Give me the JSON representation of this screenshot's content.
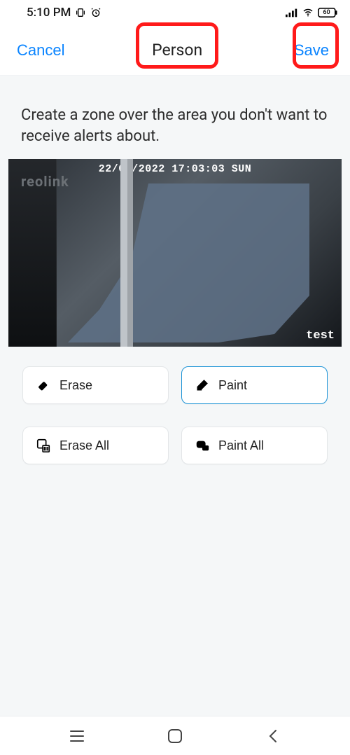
{
  "status": {
    "time": "5:10 PM",
    "battery": "60"
  },
  "nav": {
    "cancel": "Cancel",
    "title": "Person",
    "save": "Save"
  },
  "instruction": "Create a zone over the area you don't want to receive alerts about.",
  "preview": {
    "brand": "reolink",
    "timestamp": "22/05/2022 17:03:03 SUN",
    "label": "test"
  },
  "tools": {
    "erase": "Erase",
    "paint": "Paint",
    "erase_all": "Erase All",
    "paint_all": "Paint All",
    "active": "paint"
  },
  "colors": {
    "accent": "#0a84ff",
    "highlight": "#ff1a1a",
    "active_border": "#1c93d6",
    "zone_fill": "#5e7186"
  }
}
